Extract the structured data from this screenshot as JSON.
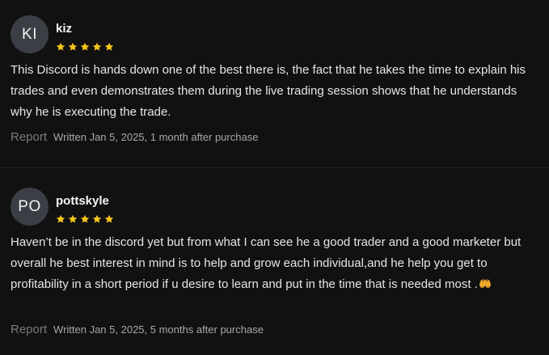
{
  "colors": {
    "background": "#111111",
    "star": "#f5c518",
    "avatar_bg": "#3b3f45"
  },
  "reviews": [
    {
      "initials": "KI",
      "name": "kiz",
      "rating": 5,
      "text": "This Discord is hands down one of the best there is, the fact that he takes the time to explain his trades and even demonstrates them during the live trading session shows that he understands why he is executing the trade.",
      "report_label": "Report",
      "written": "Written Jan 5, 2025, 1 month after purchase"
    },
    {
      "initials": "PO",
      "name": "pottskyle",
      "rating": 5,
      "text": "Haven’t be in the discord yet but from what I can see he a good trader and a good marketer but overall he best interest in mind is to help and grow each individual,and he help you get to profitability in a short period if u desire to learn and put in the time that is needed most .",
      "emoji_icon": "raising-hands-icon",
      "report_label": "Report",
      "written": "Written Jan 5, 2025, 5 months after purchase"
    }
  ]
}
